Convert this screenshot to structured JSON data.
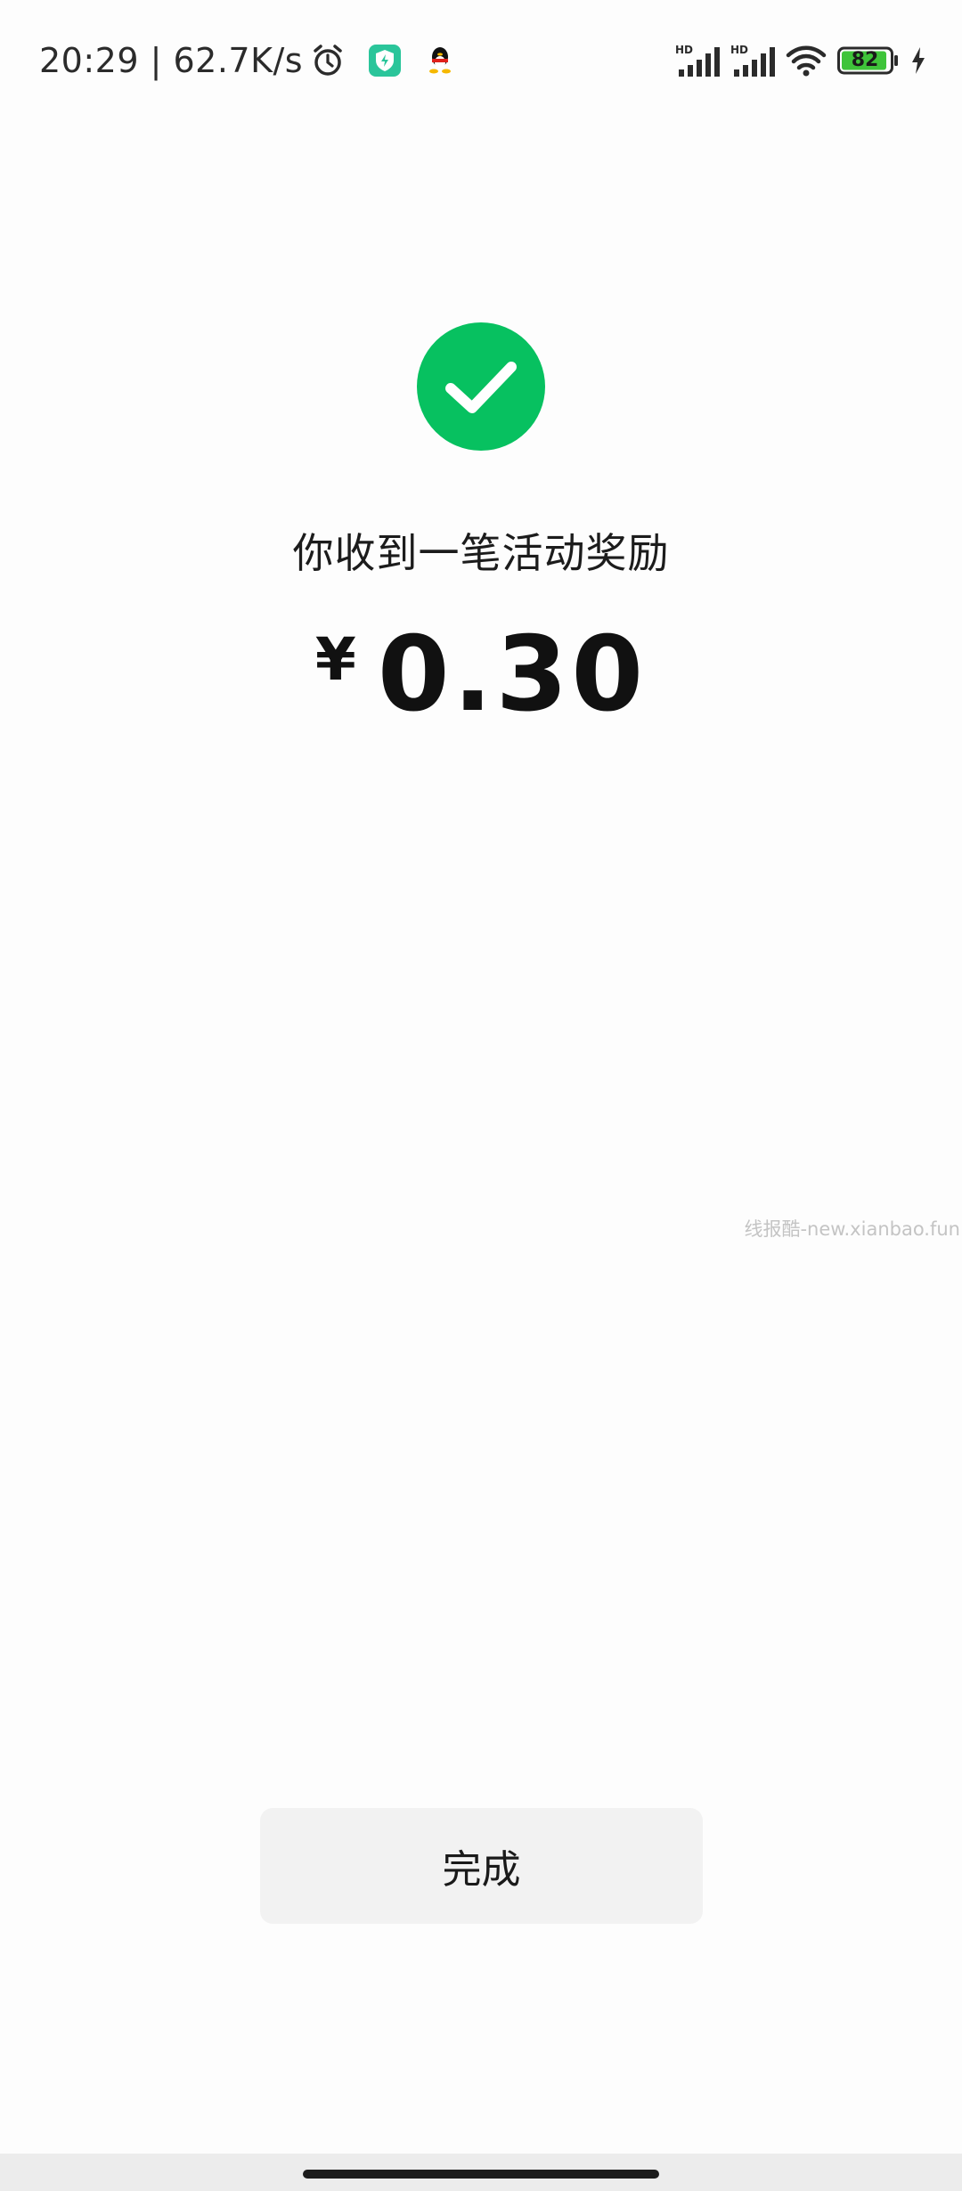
{
  "status_bar": {
    "time_speed": "20:29 | 62.7K/s",
    "battery_level": "82",
    "signal_1_label": "HD",
    "signal_2_label": "HD",
    "icons": [
      "alarm-icon",
      "shield-app-icon",
      "qq-penguin-icon",
      "signal-icon",
      "wifi-icon",
      "battery-icon",
      "charging-icon"
    ],
    "battery_color": "#3fc43a"
  },
  "result": {
    "title": "你收到一笔活动奖励",
    "currency": "¥",
    "amount": "0.30",
    "success_color": "#07c160"
  },
  "watermark": "线报酷-new.xianbao.fun",
  "actions": {
    "done_label": "完成"
  }
}
